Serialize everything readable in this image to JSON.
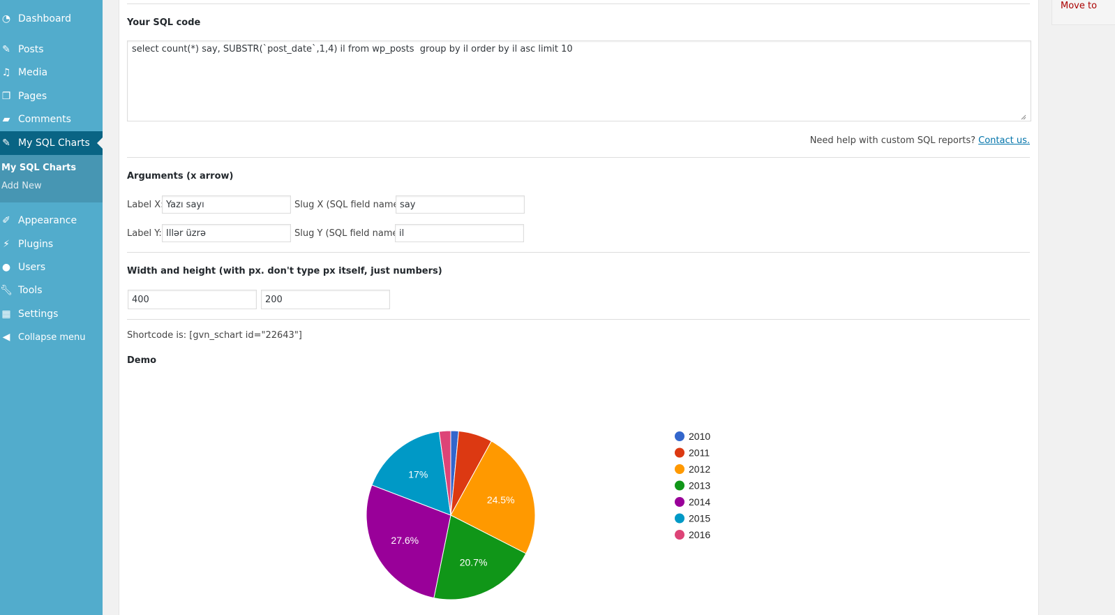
{
  "sidebar": {
    "items": [
      {
        "label": "Dashboard",
        "icon": "dashboard-icon"
      },
      {
        "label": "Posts",
        "icon": "pin-icon"
      },
      {
        "label": "Media",
        "icon": "media-icon"
      },
      {
        "label": "Pages",
        "icon": "pages-icon"
      },
      {
        "label": "Comments",
        "icon": "comment-icon"
      },
      {
        "label": "My SQL Charts",
        "icon": "pin-icon",
        "active": true
      },
      {
        "label": "Appearance",
        "icon": "paintbrush-icon"
      },
      {
        "label": "Plugins",
        "icon": "plugin-icon"
      },
      {
        "label": "Users",
        "icon": "user-icon"
      },
      {
        "label": "Tools",
        "icon": "wrench-icon"
      },
      {
        "label": "Settings",
        "icon": "settings-icon"
      }
    ],
    "submenu": [
      {
        "label": "My SQL Charts",
        "current": true
      },
      {
        "label": "Add New"
      }
    ],
    "collapse_label": "Collapse menu"
  },
  "form": {
    "sql_heading": "Your SQL code",
    "sql_value": "select count(*) say, SUBSTR(`post_date`,1,4) il from wp_posts  group by il order by il asc limit 10",
    "help_text": "Need help with custom SQL reports?",
    "help_link": "Contact us.",
    "args_heading": "Arguments (x arrow)",
    "label_x": "Label X:",
    "label_x_value": "Yazı sayı",
    "slug_x": "Slug X (SQL field name):",
    "slug_x_value": "say",
    "label_y": "Label Y:",
    "label_y_value": "İllər üzrə",
    "slug_y": "Slug Y (SQL field name):",
    "slug_y_value": "il",
    "size_heading": "Width and height (with px. don't type px itself, just numbers)",
    "width_value": "400",
    "height_value": "200",
    "shortcode": "Shortcode is: [gvn_schart id=\"22643\"]",
    "demo_heading": "Demo"
  },
  "right_panel": {
    "move_to": "Move to"
  },
  "chart_data": {
    "type": "pie",
    "title": "",
    "categories": [
      "2010",
      "2011",
      "2012",
      "2013",
      "2014",
      "2015",
      "2016"
    ],
    "values": [
      1.5,
      6.5,
      24.5,
      20.7,
      27.6,
      17.0,
      2.2
    ],
    "labels": [
      "",
      "",
      "24.5%",
      "20.7%",
      "27.6%",
      "17%",
      ""
    ],
    "colors": [
      "#3366cc",
      "#dc3912",
      "#ff9900",
      "#109618",
      "#990099",
      "#0099c6",
      "#dd4477"
    ],
    "legend": "right"
  }
}
